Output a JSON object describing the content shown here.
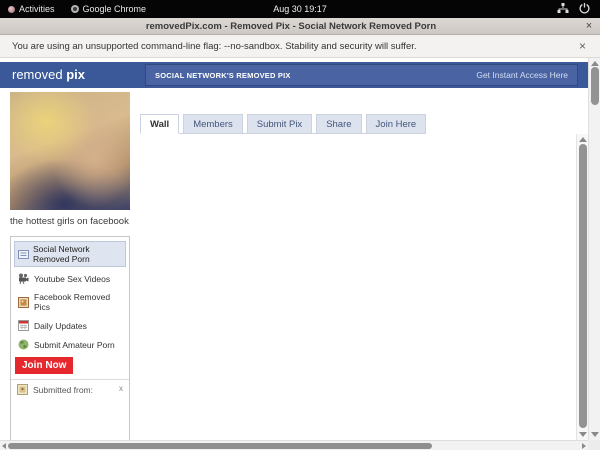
{
  "desktop": {
    "activities_label": "Activities",
    "app_label": "Google Chrome",
    "clock": "Aug 30 19:17"
  },
  "window": {
    "title": "removedPix.com - Removed Pix - Social Network Removed Porn",
    "close_label": "×"
  },
  "infobar": {
    "message": "You are using an unsupported command-line flag: --no-sandbox. Stability and security will suffer.",
    "close_label": "×"
  },
  "site": {
    "logo_first": "removed",
    "logo_second": "pix",
    "banner_title": "SOCIAL NETWORK'S REMOVED PIX",
    "access_link": "Get Instant Access Here"
  },
  "sidebar": {
    "photo_caption": "the hottest girls on facebook",
    "menu_selected": "Social Network Removed Porn",
    "menu_items": [
      {
        "label": "Youtube Sex Videos",
        "icon": "video-camera-icon"
      },
      {
        "label": "Facebook Removed Pics",
        "icon": "photo-icon"
      },
      {
        "label": "Daily Updates",
        "icon": "calendar-icon"
      },
      {
        "label": "Submit Amateur Porn",
        "icon": "globe-icon"
      },
      {
        "label": "Join Now",
        "icon": "none"
      }
    ],
    "join_button_label": "Join Now",
    "submitted_from_label": "Submitted from:",
    "submitted_close_label": "x"
  },
  "main": {
    "tabs": [
      {
        "label": "Wall",
        "active": true
      },
      {
        "label": "Members",
        "active": false
      },
      {
        "label": "Submit Pix",
        "active": false
      },
      {
        "label": "Share",
        "active": false
      },
      {
        "label": "Join Here",
        "active": false
      }
    ]
  },
  "colors": {
    "header_blue": "#3b5998",
    "banner_blue": "#4a64a3",
    "accent_red": "#e4282d",
    "tab_inactive_bg": "#dde3ee"
  }
}
